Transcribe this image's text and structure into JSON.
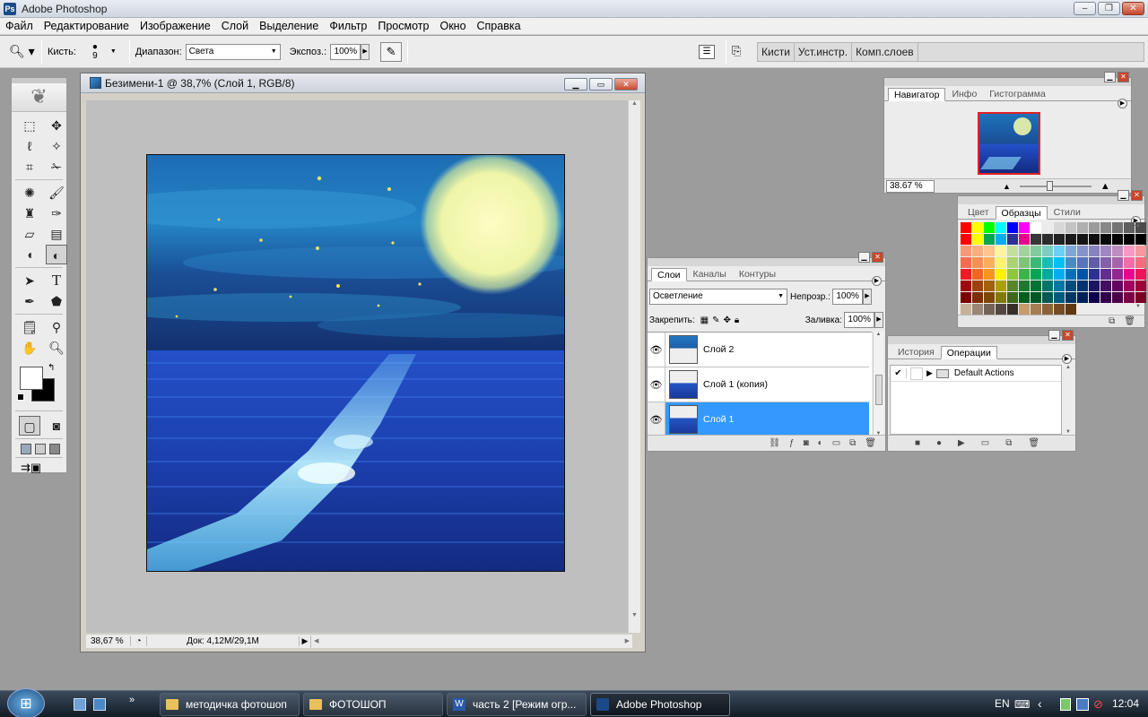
{
  "window": {
    "title": "Adobe Photoshop"
  },
  "menu": [
    "Файл",
    "Редактирование",
    "Изображение",
    "Слой",
    "Выделение",
    "Фильтр",
    "Просмотр",
    "Окно",
    "Справка"
  ],
  "options": {
    "brush_label": "Кисть:",
    "brush_size": "9",
    "range_label": "Диапазон:",
    "range_value": "Света",
    "exposure_label": "Экспоз.:",
    "exposure_value": "100%",
    "dock_tabs": [
      "Кисти",
      "Уст.инстр.",
      "Комп.слоев"
    ]
  },
  "document": {
    "title": "Безимени-1 @ 38,7% (Слой 1, RGB/8)",
    "zoom": "38,67 %",
    "doc_info": "Док: 4,12M/29,1M"
  },
  "navigator": {
    "tabs": [
      "Навигатор",
      "Инфо",
      "Гистограмма"
    ],
    "zoom": "38.67 %",
    "zoom_slider_fraction": 0.4
  },
  "swatches": {
    "tabs": [
      "Цвет",
      "Образцы",
      "Стили"
    ],
    "rows": [
      [
        "#ff0000",
        "#ffff00",
        "#00ff00",
        "#00ffff",
        "#0000ff",
        "#ff00ff",
        "#ffffff",
        "#ebebeb",
        "#d7d7d7",
        "#c3c3c3",
        "#afafaf",
        "#9b9b9b",
        "#878787",
        "#737373",
        "#5f5f5f",
        "#4b4b4b"
      ],
      [
        "#ff0000",
        "#ffff00",
        "#00a651",
        "#00aeef",
        "#2e3192",
        "#ec008c",
        "#373737",
        "#2d2d2d",
        "#232323",
        "#191919",
        "#141414",
        "#0f0f0f",
        "#0a0a0a",
        "#050505",
        "#000000",
        "#000000"
      ],
      [
        "#f7977a",
        "#f9ad81",
        "#fdc68a",
        "#fff79a",
        "#c4df9b",
        "#a3d39c",
        "#82ca9d",
        "#7bcdc8",
        "#6ecff6",
        "#7ea7d8",
        "#8493ca",
        "#8882be",
        "#a187be",
        "#bc8dbf",
        "#f49ac2",
        "#f6989d"
      ],
      [
        "#f26c4f",
        "#f68e55",
        "#fbaf5c",
        "#fff467",
        "#acd372",
        "#7cc576",
        "#3bb878",
        "#1abbb4",
        "#00bff3",
        "#438cca",
        "#5574b9",
        "#605ca8",
        "#855fa8",
        "#a763a8",
        "#f06eaa",
        "#f26d7d"
      ],
      [
        "#ed1c24",
        "#f26522",
        "#f7941d",
        "#fff200",
        "#8dc73f",
        "#39b54a",
        "#00a651",
        "#00a99d",
        "#00aeef",
        "#0072bc",
        "#0054a6",
        "#2e3192",
        "#662d91",
        "#92278f",
        "#ec008c",
        "#ed145b"
      ],
      [
        "#9e0b0f",
        "#a0410d",
        "#a36209",
        "#aba000",
        "#598527",
        "#1a7b30",
        "#007236",
        "#00746b",
        "#0076a3",
        "#004b80",
        "#003471",
        "#1b1464",
        "#440e62",
        "#630460",
        "#9e005d",
        "#9e0039"
      ],
      [
        "#790000",
        "#7b2e00",
        "#7d4900",
        "#827b00",
        "#406618",
        "#005e20",
        "#005826",
        "#005952",
        "#005b7f",
        "#003663",
        "#002157",
        "#0d004c",
        "#32004b",
        "#4b0049",
        "#7b0046",
        "#7a0026"
      ],
      [
        "#c7b299",
        "#998675",
        "#736357",
        "#534741",
        "#37302a",
        "#c69c6d",
        "#a67c52",
        "#8c6239",
        "#754c24",
        "#603913"
      ]
    ]
  },
  "layers": {
    "tabs": [
      "Слои",
      "Каналы",
      "Контуры"
    ],
    "blend_mode": "Осветление",
    "opacity_label": "Непрозр.:",
    "opacity": "100%",
    "lock_label": "Закрепить:",
    "fill_label": "Заливка:",
    "fill": "100%",
    "items": [
      {
        "name": "Слой 2"
      },
      {
        "name": "Слой 1 (копия)"
      },
      {
        "name": "Слой 1"
      }
    ]
  },
  "actions": {
    "tabs": [
      "История",
      "Операции"
    ],
    "set_name": "Default Actions"
  },
  "taskbar": {
    "buttons": [
      "методичка фотошоп",
      "ФОТОШОП",
      "часть 2 [Режим огр...",
      "Adobe Photoshop"
    ],
    "lang": "EN",
    "time": "12:04"
  }
}
